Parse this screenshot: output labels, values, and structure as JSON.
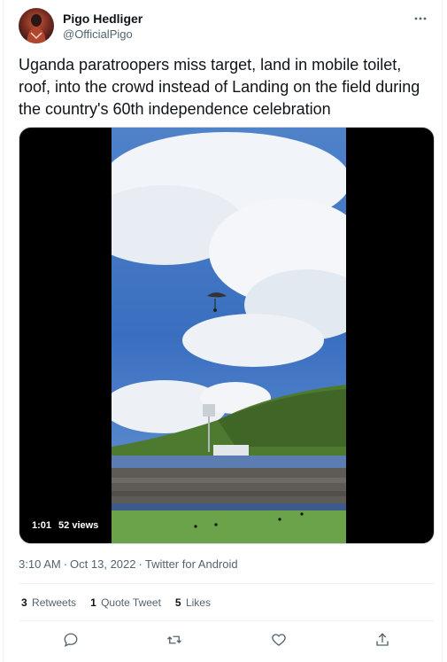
{
  "author": {
    "name": "Pigo Hedliger",
    "handle": "@OfficialPigo"
  },
  "tweet": {
    "text": "Uganda paratroopers miss target, land in mobile toilet, roof, into the crowd instead of Landing on the field during the country's 60th independence celebration"
  },
  "video": {
    "duration": "1:01",
    "views": "52 views"
  },
  "meta": {
    "time": "3:10 AM",
    "date": "Oct 13, 2022",
    "source": "Twitter for Android",
    "separator": "·"
  },
  "stats": {
    "retweets_count": "3",
    "retweets_label": "Retweets",
    "quotes_count": "1",
    "quotes_label": "Quote Tweet",
    "likes_count": "5",
    "likes_label": "Likes"
  },
  "actions": {
    "reply": "reply-icon",
    "retweet": "retweet-icon",
    "like": "heart-icon",
    "share": "share-icon"
  },
  "colors": {
    "text": "#0f1419",
    "muted": "#536471",
    "border": "#eff3f4"
  }
}
